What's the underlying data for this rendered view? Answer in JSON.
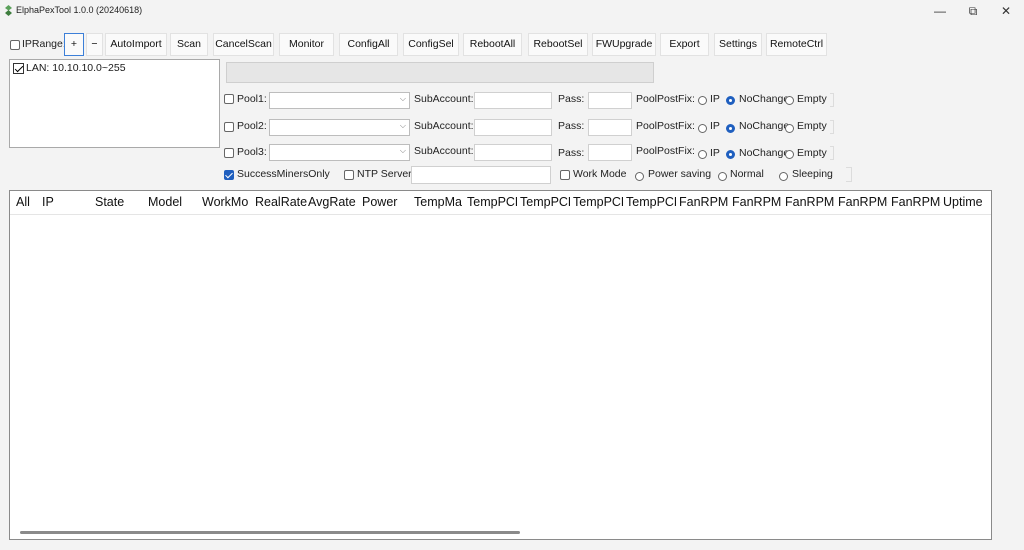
{
  "window": {
    "title": "ElphaPexTool 1.0.0 (20240618)",
    "minimize": "—",
    "restore": "⧉",
    "close": "✕"
  },
  "toolbar": {
    "iprange_label": "IPRange:",
    "add": "+",
    "remove": "−",
    "buttons": [
      "AutoImport",
      "Scan",
      "CancelScan",
      "Monitor",
      "ConfigAll",
      "ConfigSel",
      "RebootAll",
      "RebootSel",
      "FWUpgrade",
      "Export",
      "Settings",
      "RemoteCtrl"
    ]
  },
  "tree": {
    "items": [
      {
        "label": "LAN: 10.10.10.0~255",
        "checked": true
      }
    ]
  },
  "pools": [
    {
      "label": "Pool1:",
      "sub_label": "SubAccount:",
      "pass_label": "Pass:",
      "postfix_label": "PoolPostFix:",
      "opt_ip": "IP",
      "opt_nochange": "NoChange",
      "opt_empty": "Empty",
      "selected": "NoChange"
    },
    {
      "label": "Pool2:",
      "sub_label": "SubAccount:",
      "pass_label": "Pass:",
      "postfix_label": "PoolPostFix:",
      "opt_ip": "IP",
      "opt_nochange": "NoChange",
      "opt_empty": "Empty",
      "selected": "NoChange"
    },
    {
      "label": "Pool3:",
      "sub_label": "SubAccount:",
      "pass_label": "Pass:",
      "postfix_label": "PoolPostFix:",
      "opt_ip": "IP",
      "opt_nochange": "NoChange",
      "opt_empty": "Empty",
      "selected": "NoChange"
    }
  ],
  "options": {
    "success_only": "SuccessMinersOnly",
    "success_only_checked": true,
    "ntp_server": "NTP Server",
    "work_mode": "Work Mode",
    "power_saving": "Power saving",
    "normal": "Normal",
    "sleeping": "Sleeping"
  },
  "table": {
    "columns": [
      "All",
      "IP",
      "State",
      "Model",
      "WorkMo",
      "RealRate",
      "AvgRate",
      "Power",
      "TempMa",
      "TempPCE",
      "TempPCE",
      "TempPCE",
      "TempPCE",
      "FanRPM",
      "FanRPMi",
      "FanRPMi",
      "FanRPMc",
      "FanRPMc",
      "Uptime"
    ]
  }
}
